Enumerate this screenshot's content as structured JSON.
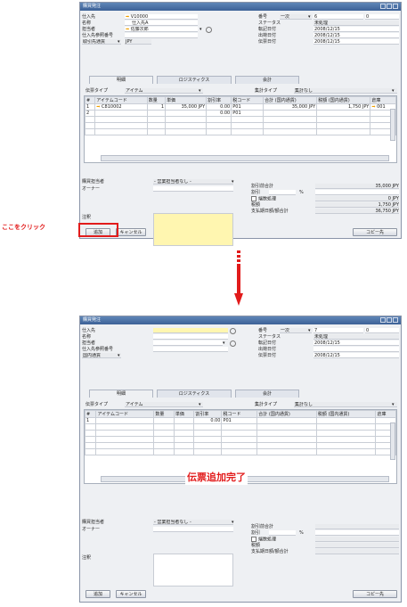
{
  "callout_text": "ここをクリック",
  "done_text": "伝票追加完了",
  "before": {
    "title": "購買発注",
    "left_labels": [
      "仕入先",
      "名称",
      "担当者",
      "仕入先参照番号"
    ],
    "vendor_code": "V10000",
    "vendor_name": "仕入先A",
    "contact": "佐藤次郎",
    "currency_select": "取引先通貨",
    "currency_code": "JPY",
    "right_labels": [
      "番号",
      "ステータス",
      "転記日付",
      "出荷日付",
      "伝票日付"
    ],
    "series": "一次",
    "doc_number": "6",
    "doc_sub": "0",
    "status": "未処理",
    "posting_date": "2008/12/15",
    "delivery_date": "2008/12/15",
    "doc_date": "2008/12/15",
    "tabs": [
      "明細",
      "ロジスティクス",
      "会計"
    ],
    "item_type_label": "伝票タイプ",
    "item_type": "アイテム",
    "summary_type_label": "集計タイプ",
    "summary_type": "集計なし",
    "grid_headers": [
      "#",
      "アイテムコード",
      "数量",
      "単価",
      "割引率",
      "税コード",
      "合計 (国内通貨)",
      "税額 (国内通貨)",
      "倉庫"
    ],
    "rows": [
      {
        "no": "1",
        "code": "C810002",
        "qty": "1",
        "price": "35,000 JPY",
        "disc": "0.00",
        "tax": "P01",
        "total": "35,000 JPY",
        "taxamt": "1,750 JPY",
        "wh": "001"
      },
      {
        "no": "2",
        "code": "",
        "qty": "",
        "price": "",
        "disc": "0.00",
        "tax": "P01",
        "total": "",
        "taxamt": "",
        "wh": ""
      }
    ],
    "buyer_label": "購買担当者",
    "buyer": "- 営業担当者なし -",
    "owner_label": "オーナー",
    "memo_label": "注釈",
    "totals_labels": [
      "割引前合計",
      "割引",
      "端数処理",
      "税額",
      "支払期日額/額合計"
    ],
    "percent_sign": "%",
    "total_before_disc": "35,000 JPY",
    "rounding": "0 JPY",
    "tax_total": "1,750 JPY",
    "total_due": "36,750 JPY",
    "add_button": "追加",
    "cancel_button": "キャンセル",
    "copy_button": "コピー先"
  },
  "after": {
    "title": "購買発注",
    "left_labels": [
      "仕入先",
      "名称",
      "担当者",
      "仕入先参照番号"
    ],
    "currency_select": "国内通貨",
    "right_labels": [
      "番号",
      "ステータス",
      "転記日付",
      "出荷日付",
      "伝票日付"
    ],
    "series": "一次",
    "doc_number": "7",
    "doc_sub": "0",
    "status": "未処理",
    "posting_date": "2008/12/15",
    "doc_date": "2008/12/15",
    "tabs": [
      "明細",
      "ロジスティクス",
      "会計"
    ],
    "item_type_label": "伝票タイプ",
    "item_type": "アイテム",
    "summary_type_label": "集計タイプ",
    "summary_type": "集計なし",
    "grid_headers": [
      "#",
      "アイテムコード",
      "数量",
      "単価",
      "割引率",
      "税コード",
      "合計 (国内通貨)",
      "税額 (国内通貨)",
      "倉庫"
    ],
    "rows": [
      {
        "no": "1",
        "code": "",
        "qty": "",
        "price": "",
        "disc": "0.00",
        "tax": "P01",
        "total": "",
        "taxamt": "",
        "wh": ""
      }
    ],
    "buyer_label": "購買担当者",
    "buyer": "- 営業担当者なし -",
    "owner_label": "オーナー",
    "memo_label": "注釈",
    "totals_labels": [
      "割引前合計",
      "割引",
      "端数処理",
      "税額",
      "支払期日額/額合計"
    ],
    "percent_sign": "%",
    "add_button": "追加",
    "cancel_button": "キャンセル",
    "copy_button": "コピー先"
  },
  "colors": {
    "accent_red": "#e21b1b",
    "field_yellow": "#fff6b0",
    "title_blue": "#4a70a6"
  }
}
